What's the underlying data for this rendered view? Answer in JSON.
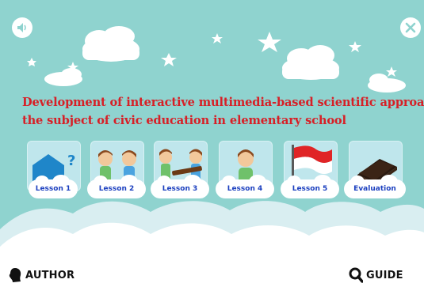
{
  "header": {
    "sound_icon": "speaker-icon",
    "close_icon": "close-icon"
  },
  "title": {
    "line1": "Development of interactive multimedia-based scientific approach on",
    "line2": "the subject of civic education in elementary school"
  },
  "lessons": [
    {
      "label": "Lesson 1",
      "icon": "house-question-icon"
    },
    {
      "label": "Lesson 2",
      "icon": "two-kids-icon"
    },
    {
      "label": "Lesson 3",
      "icon": "kids-carrying-log-icon"
    },
    {
      "label": "Lesson 4",
      "icon": "kid-icon"
    },
    {
      "label": "Lesson 5",
      "icon": "indonesia-flag-icon"
    },
    {
      "label": "Evaluation",
      "icon": "book-icon"
    }
  ],
  "footer": {
    "author_label": "AUTHOR",
    "guide_label": "GUIDE"
  },
  "colors": {
    "background": "#8fd3cf",
    "title": "#d71f26",
    "lesson_label": "#1b3fbf",
    "card": "#bfe6ec"
  }
}
